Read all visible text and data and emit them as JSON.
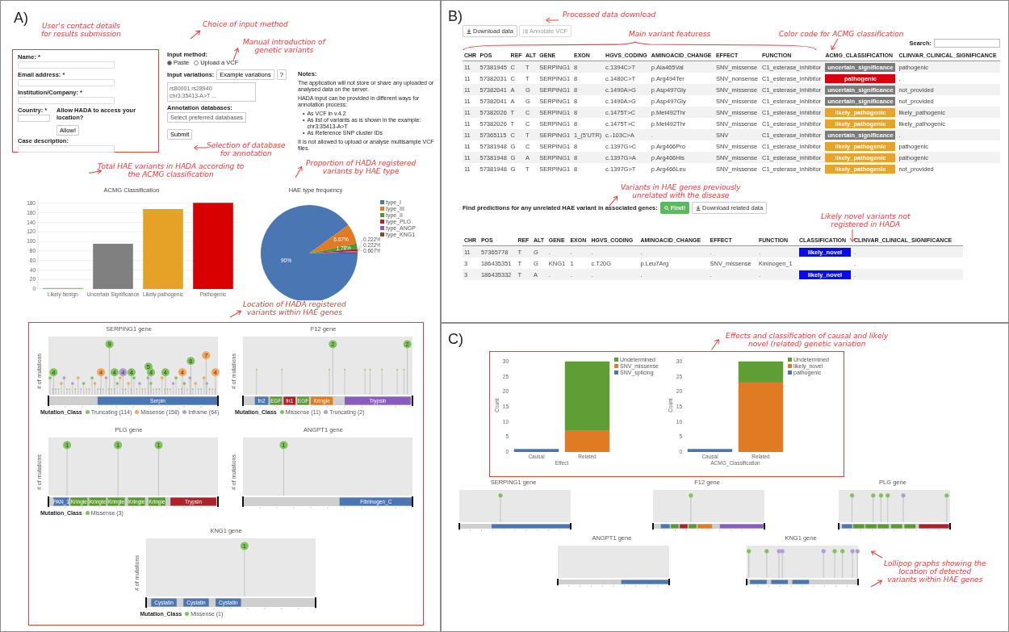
{
  "panel_a": {
    "label": "A)",
    "annotations": [
      "User's contact details\nfor results submission",
      "Choice of input method",
      "Manual introduction of\ngenetic variants",
      "Selection of database\nfor annotation",
      "Total HAE variants in HADA according to\nthe ACMG classification",
      "Proportion of HADA registered\nvariants by HAE type",
      "Location of HADA registered\nvariants within HAE genes"
    ],
    "form": {
      "fields": [
        "Name: *",
        "Email address: *",
        "Institution/Company: *"
      ],
      "country_label": "Country: *",
      "location_label": "Allow HADA to access your location?",
      "allow_button": "Allow!",
      "case_label": "Case description:"
    },
    "input": {
      "method_label": "Input method:",
      "methods": [
        {
          "label": "Paste",
          "selected": true
        },
        {
          "label": "Upload a VCF",
          "selected": false
        }
      ],
      "variations_label": "Input variations:",
      "example_button": "Example variations",
      "help_button": "?",
      "textarea_value": "rs80001 rs28940\nchr3:35413-A>T ...",
      "db_label": "Annotation databases:",
      "db_placeholder": "Select preferred databases",
      "submit": "Submit"
    },
    "notes": {
      "title": "Notes:",
      "intro": "The application will not store or share any uploaded or analysed data on the server.",
      "ways": "HADA input can be provided in different ways for annotation process:",
      "bullets": [
        {
          "marker": "•",
          "text": "As VCF in v.4.2"
        },
        {
          "marker": "•",
          "text": "As list of variants as is shown in the example: chr3:35413-A>T"
        },
        {
          "marker": "•",
          "text": "As Reference SNP cluster IDs"
        }
      ],
      "outro": "It is not allowed to upload or analyse multisample VCF files."
    },
    "bar_chart": {
      "chart_data": {
        "type": "bar",
        "title": "ACMG Classification",
        "categories": [
          "Likely benign",
          "Uncertain Significance",
          "Likely pathogenic",
          "Pathogenic"
        ],
        "values": [
          2,
          95,
          168,
          181
        ],
        "ylim": [
          0,
          190
        ],
        "yticks": [
          0,
          20,
          40,
          60,
          80,
          100,
          120,
          140,
          160,
          180
        ],
        "grid": true
      },
      "bar_colors": [
        {
          "color": "#7fc45a"
        },
        {
          "color": "#808080"
        },
        {
          "color": "#e5a227"
        },
        {
          "color": "#d80000"
        }
      ]
    },
    "pie_chart": {
      "chart_data": {
        "type": "pie",
        "title": "HAE type frequency",
        "categories": [
          "type_I",
          "type_III",
          "type_II",
          "type_PLG",
          "type_ANGP",
          "type_KNG1"
        ],
        "values": [
          90,
          6.67,
          1.78,
          0.667,
          0.222,
          0.222
        ],
        "value_labels": [
          "90%",
          "6.67%",
          "1.78%",
          "0.667%",
          "0.222%",
          "0.222%"
        ],
        "legend": "right"
      },
      "slice_colors": [
        {
          "color": "#4a77b4"
        },
        {
          "color": "#e07b24"
        },
        {
          "color": "#4a9a2c"
        },
        {
          "color": "#b0202a"
        },
        {
          "color": "#8a5cc0"
        },
        {
          "color": "#7a4a3a"
        }
      ]
    },
    "plots": [
      {
        "title": "SERPING1 gene",
        "ylabel": "# of mutations",
        "heads": [
          {
            "count": "4",
            "color": "#7fc45a"
          },
          {
            "count": "4",
            "color": "#f5a65b"
          },
          {
            "count": "9",
            "color": "#7fc45a"
          },
          {
            "count": "4",
            "color": "#7fc45a"
          },
          {
            "count": "4",
            "color": "#b59bd6"
          },
          {
            "count": "4",
            "color": "#7fc45a"
          },
          {
            "count": "5",
            "color": "#7fc45a"
          },
          {
            "count": "4",
            "color": "#7fc45a"
          },
          {
            "count": "4",
            "color": "#7fc45a"
          },
          {
            "count": "4",
            "color": "#f5a65b"
          },
          {
            "count": "6",
            "color": "#7fc45a"
          },
          {
            "count": "7",
            "color": "#f5a65b"
          },
          {
            "count": "4",
            "color": "#f5a65b"
          }
        ],
        "domains": [
          {
            "label": "Serpin",
            "color": "#4a77b4"
          }
        ],
        "legend_title": "Mutation_Class",
        "legend": [
          {
            "label": "Truncating (114)",
            "color": "#7fc45a"
          },
          {
            "label": "Missense (158)",
            "color": "#f5a65b"
          },
          {
            "label": "Inframe (64)",
            "color": "#b59bd6"
          }
        ]
      },
      {
        "title": "F12 gene",
        "ylabel": "# of mutations",
        "heads": [
          {
            "count": "2",
            "color": "#7fc45a"
          },
          {
            "count": "2",
            "color": "#7fc45a"
          }
        ],
        "domains": [
          {
            "label": "fn2",
            "color": "#4a77b4"
          },
          {
            "label": "EGF",
            "color": "#5a9a30"
          },
          {
            "label": "fn1",
            "color": "#b0202a"
          },
          {
            "label": "EGF",
            "color": "#5a9a30"
          },
          {
            "label": "Kringle",
            "color": "#e07b24"
          },
          {
            "label": "Trypsin",
            "color": "#8a5cc0"
          }
        ],
        "legend_title": "Mutation_Class",
        "legend": [
          {
            "label": "Missense (11)",
            "color": "#7fc45a"
          },
          {
            "label": "Truncating (2)",
            "color": "#b59bd6"
          }
        ]
      },
      {
        "title": "PLG gene",
        "ylabel": "# of mutations",
        "heads": [
          {
            "count": "1",
            "color": "#7fc45a"
          },
          {
            "count": "1",
            "color": "#7fc45a"
          },
          {
            "count": "1",
            "color": "#7fc45a"
          }
        ],
        "domains": [
          {
            "label": "PAN_1",
            "color": "#4a77b4"
          },
          {
            "label": "Kringle",
            "color": "#5a9a30"
          },
          {
            "label": "Kringle",
            "color": "#5a9a30"
          },
          {
            "label": "Kringle",
            "color": "#5a9a30"
          },
          {
            "label": "Kringle",
            "color": "#5a9a30"
          },
          {
            "label": "Kringle",
            "color": "#5a9a30"
          },
          {
            "label": "Trypsin",
            "color": "#b0202a"
          }
        ],
        "legend_title": "Mutation_Class",
        "legend": [
          {
            "label": "Missense (3)",
            "color": "#7fc45a"
          }
        ]
      },
      {
        "title": "ANGPT1 gene",
        "ylabel": "# of mutations",
        "heads": [
          {
            "count": "1",
            "color": "#7fc45a"
          }
        ],
        "domains": [
          {
            "label": "Fibrinogen_C",
            "color": "#4a77b4"
          }
        ]
      },
      {
        "title": "KNG1 gene",
        "ylabel": "# of mutations",
        "heads": [
          {
            "count": "1",
            "color": "#7fc45a"
          }
        ],
        "domains": [
          {
            "label": "Cystatin",
            "color": "#4a77b4"
          },
          {
            "label": "Cystatin",
            "color": "#4a77b4"
          },
          {
            "label": "Cystatin",
            "color": "#4a77b4"
          }
        ],
        "legend_title": "Mutation_Class",
        "legend": [
          {
            "label": "Missense (1)",
            "color": "#7fc45a"
          }
        ]
      }
    ]
  },
  "panel_b": {
    "label": "B)",
    "annotations": [
      "Processed data download",
      "Main variant featuress",
      "Color code for ACMG classification",
      "Variants in HAE genes previously\nunrelated with the disease",
      "Likely novel variants not\nregistered in HADA"
    ],
    "buttons": [
      {
        "label": "Download data",
        "disabled": false
      },
      {
        "label": "Annotate VCF",
        "disabled": true
      }
    ],
    "search_label": "Search:",
    "columns": [
      "CHR",
      "POS",
      "REF",
      "ALT",
      "GENE",
      "EXON",
      "HGVS_CODING",
      "AMINOACID_CHANGE",
      "EFFECT",
      "FUNCTION",
      "ACMG_CLASSIFICATION",
      "CLINVAR_CLINICAL_SIGNIFICANCE"
    ],
    "rows": [
      {
        "cells": [
          "11",
          "57381945",
          "C",
          "T",
          "SERPING1",
          "8",
          "c.1394C>T",
          "p.Ala465Val",
          "SNV_missense",
          "C1_esterase_inhibitor"
        ],
        "badge": {
          "text": "uncertain_significance",
          "color": "#7a7a7a"
        },
        "clinvar": "pathogenic"
      },
      {
        "cells": [
          "11",
          "57382031",
          "C",
          "T",
          "SERPING1",
          "8",
          "c.1480C>T",
          "p.Arg494Ter",
          "SNV_nonsense",
          "C1_esterase_inhibitor"
        ],
        "badge": {
          "text": "pathogenic",
          "color": "#d9000b"
        },
        "clinvar": "."
      },
      {
        "cells": [
          "11",
          "57382041",
          "A",
          "G",
          "SERPING1",
          "8",
          "c.1490A>G",
          "p.Asp497Gly",
          "SNV_missense",
          "C1_esterase_inhibitor"
        ],
        "badge": {
          "text": "uncertain_significance",
          "color": "#7a7a7a"
        },
        "clinvar": "not_provided"
      },
      {
        "cells": [
          "11",
          "57382041",
          "A",
          "G",
          "SERPING1",
          "8",
          "c.1490A>G",
          "p.Asp497Gly",
          "SNV_missense",
          "C1_esterase_inhibitor"
        ],
        "badge": {
          "text": "uncertain_significance",
          "color": "#7a7a7a"
        },
        "clinvar": "not_provided"
      },
      {
        "cells": [
          "11",
          "57382026",
          "T",
          "C",
          "SERPING1",
          "8",
          "c.1475T>C",
          "p.Met492Thr",
          "SNV_missense",
          "C1_esterase_inhibitor"
        ],
        "badge": {
          "text": "likely_pathogenic",
          "color": "#e8a42a"
        },
        "clinvar": "likely_pathogenic"
      },
      {
        "cells": [
          "11",
          "57382026",
          "T",
          "C",
          "SERPING1",
          "8",
          "c.1475T>C",
          "p.Met492Thr",
          "SNV_missense",
          "C1_esterase_inhibitor"
        ],
        "badge": {
          "text": "likely_pathogenic",
          "color": "#e8a42a"
        },
        "clinvar": "likely_pathogenic"
      },
      {
        "cells": [
          "11",
          "57365115",
          "C",
          "T",
          "SERPING1",
          "1_(5'UTR)",
          "c.-103C>A",
          ".",
          "SNV",
          "C1_esterase_inhibitor"
        ],
        "badge": {
          "text": "uncertain_significance",
          "color": "#7a7a7a"
        },
        "clinvar": "."
      },
      {
        "cells": [
          "11",
          "57381948",
          "G",
          "C",
          "SERPING1",
          "8",
          "c.1397G>C",
          "p.Arg466Pro",
          "SNV_missense",
          "C1_esterase_inhibitor"
        ],
        "badge": {
          "text": "likely_pathogenic",
          "color": "#e8a42a"
        },
        "clinvar": "pathogenic"
      },
      {
        "cells": [
          "11",
          "57381948",
          "G",
          "A",
          "SERPING1",
          "8",
          "c.1397G>A",
          "p.Arg466His",
          "SNV_missense",
          "C1_esterase_inhibitor"
        ],
        "badge": {
          "text": "likely_pathogenic",
          "color": "#e8a42a"
        },
        "clinvar": "pathogenic"
      },
      {
        "cells": [
          "11",
          "57381948",
          "G",
          "T",
          "SERPING1",
          "8",
          "c.1397G>T",
          "p.Arg466Leu",
          "SNV_missense",
          "C1_esterase_inhibitor"
        ],
        "badge": {
          "text": "likely_pathogenic",
          "color": "#e8a42a"
        },
        "clinvar": "not_provided"
      }
    ],
    "find_label": "Find predictions for any unrelated HAE variant in associated genes:",
    "find_button": "Find!",
    "download_related": "Download related data",
    "columns2": [
      "CHR",
      "POS",
      "REF",
      "ALT",
      "GENE",
      "EXON",
      "HGVS_CODING",
      "AMINOACID_CHANGE",
      "EFFECT",
      "FUNCTION",
      "CLASSIFICATION",
      "CLINVAR_CLINICAL_SIGNIFICANCE"
    ],
    "rows2": [
      {
        "cells": [
          "11",
          "57365778",
          "T",
          "G",
          ".",
          ".",
          ".",
          ".",
          ".",
          "."
        ],
        "badge": {
          "text": "likely_novel",
          "color": "#0a0af0"
        },
        "clinvar": "."
      },
      {
        "cells": [
          "3",
          "186435351",
          "T",
          "G",
          "KNG1",
          "1",
          "c.T20G",
          "p.Leu7Arg",
          "SNV_missense",
          "Kininogen_1"
        ],
        "clinvar": "."
      },
      {
        "cells": [
          "3",
          "186435332",
          "T",
          "A",
          ".",
          ".",
          ".",
          ".",
          ".",
          "."
        ],
        "badge": {
          "text": "likely_novel",
          "color": "#0a0af0"
        },
        "clinvar": "."
      }
    ]
  },
  "panel_c": {
    "label": "C)",
    "annotations": [
      "Effects and classification of causal and likely\nnovel (related) genetic variation",
      "Lollipop graphs showing the\nlocation of detected\nvariants within HAE genes"
    ],
    "charts": [
      {
        "chart_data": {
          "type": "bar",
          "stacked": true,
          "categories": [
            "Causal",
            "Related"
          ],
          "xlabel": "Effect",
          "ylabel": "Count",
          "series": [
            {
              "name": "Undetermined",
              "color": "#5e9e34",
              "values": [
                0,
                23
              ]
            },
            {
              "name": "SNV_missense",
              "color": "#e07b24",
              "values": [
                0,
                7
              ]
            },
            {
              "name": "SNV_splicing",
              "color": "#4a77b4",
              "values": [
                1,
                0
              ]
            }
          ],
          "ylim": [
            0,
            31
          ],
          "yticks": [
            0,
            5,
            10,
            15,
            20,
            25,
            30
          ],
          "legend": "right"
        }
      },
      {
        "chart_data": {
          "type": "bar",
          "stacked": true,
          "categories": [
            "Causal",
            "Related"
          ],
          "xlabel": "ACMG_Classification",
          "ylabel": "Count",
          "series": [
            {
              "name": "Undetermined",
              "color": "#5e9e34",
              "values": [
                0,
                7
              ]
            },
            {
              "name": "likely_novel",
              "color": "#e07b24",
              "values": [
                0,
                23
              ]
            },
            {
              "name": "pathogenic",
              "color": "#4a77b4",
              "values": [
                1,
                0
              ]
            }
          ],
          "ylim": [
            0,
            31
          ],
          "yticks": [
            0,
            5,
            10,
            15,
            20,
            25,
            30
          ],
          "legend": "right"
        }
      }
    ],
    "plots": [
      {
        "title": "SERPING1 gene",
        "heads": [
          {
            "color": "#7fc45a"
          }
        ],
        "domains": [
          {
            "color": "#4a77b4"
          }
        ]
      },
      {
        "title": "F12 gene",
        "heads": [
          {
            "color": "#7fc45a"
          }
        ],
        "domains": [
          {
            "color": "#4a77b4"
          },
          {
            "color": "#5a9a30"
          },
          {
            "color": "#b0202a"
          },
          {
            "color": "#5a9a30"
          },
          {
            "color": "#e07b24"
          },
          {
            "color": "#8a5cc0"
          }
        ]
      },
      {
        "title": "PLG gene",
        "heads": [
          {
            "color": "#7fc45a"
          },
          {
            "color": "#7fc45a"
          },
          {
            "color": "#7fc45a"
          },
          {
            "color": "#7fc45a"
          },
          {
            "color": "#b59bd6"
          },
          {
            "color": "#7fc45a"
          }
        ],
        "domains": [
          {
            "color": "#4a77b4"
          },
          {
            "color": "#5a9a30"
          },
          {
            "color": "#5a9a30"
          },
          {
            "color": "#5a9a30"
          },
          {
            "color": "#5a9a30"
          },
          {
            "color": "#5a9a30"
          },
          {
            "color": "#b0202a"
          }
        ]
      },
      {
        "title": "ANGPT1 gene",
        "domains": [
          {
            "color": "#4a77b4"
          }
        ]
      },
      {
        "title": "KNG1 gene",
        "heads": [
          {
            "color": "#7fc45a"
          },
          {
            "color": "#7fc45a"
          },
          {
            "color": "#b59bd6"
          },
          {
            "color": "#b59bd6"
          },
          {
            "color": "#b59bd6"
          },
          {
            "color": "#7fc45a"
          },
          {
            "color": "#7fc45a"
          },
          {
            "color": "#b59bd6"
          },
          {
            "color": "#b59bd6"
          }
        ],
        "domains": [
          {
            "color": "#4a77b4"
          },
          {
            "color": "#4a77b4"
          },
          {
            "color": "#4a77b4"
          }
        ]
      }
    ]
  }
}
